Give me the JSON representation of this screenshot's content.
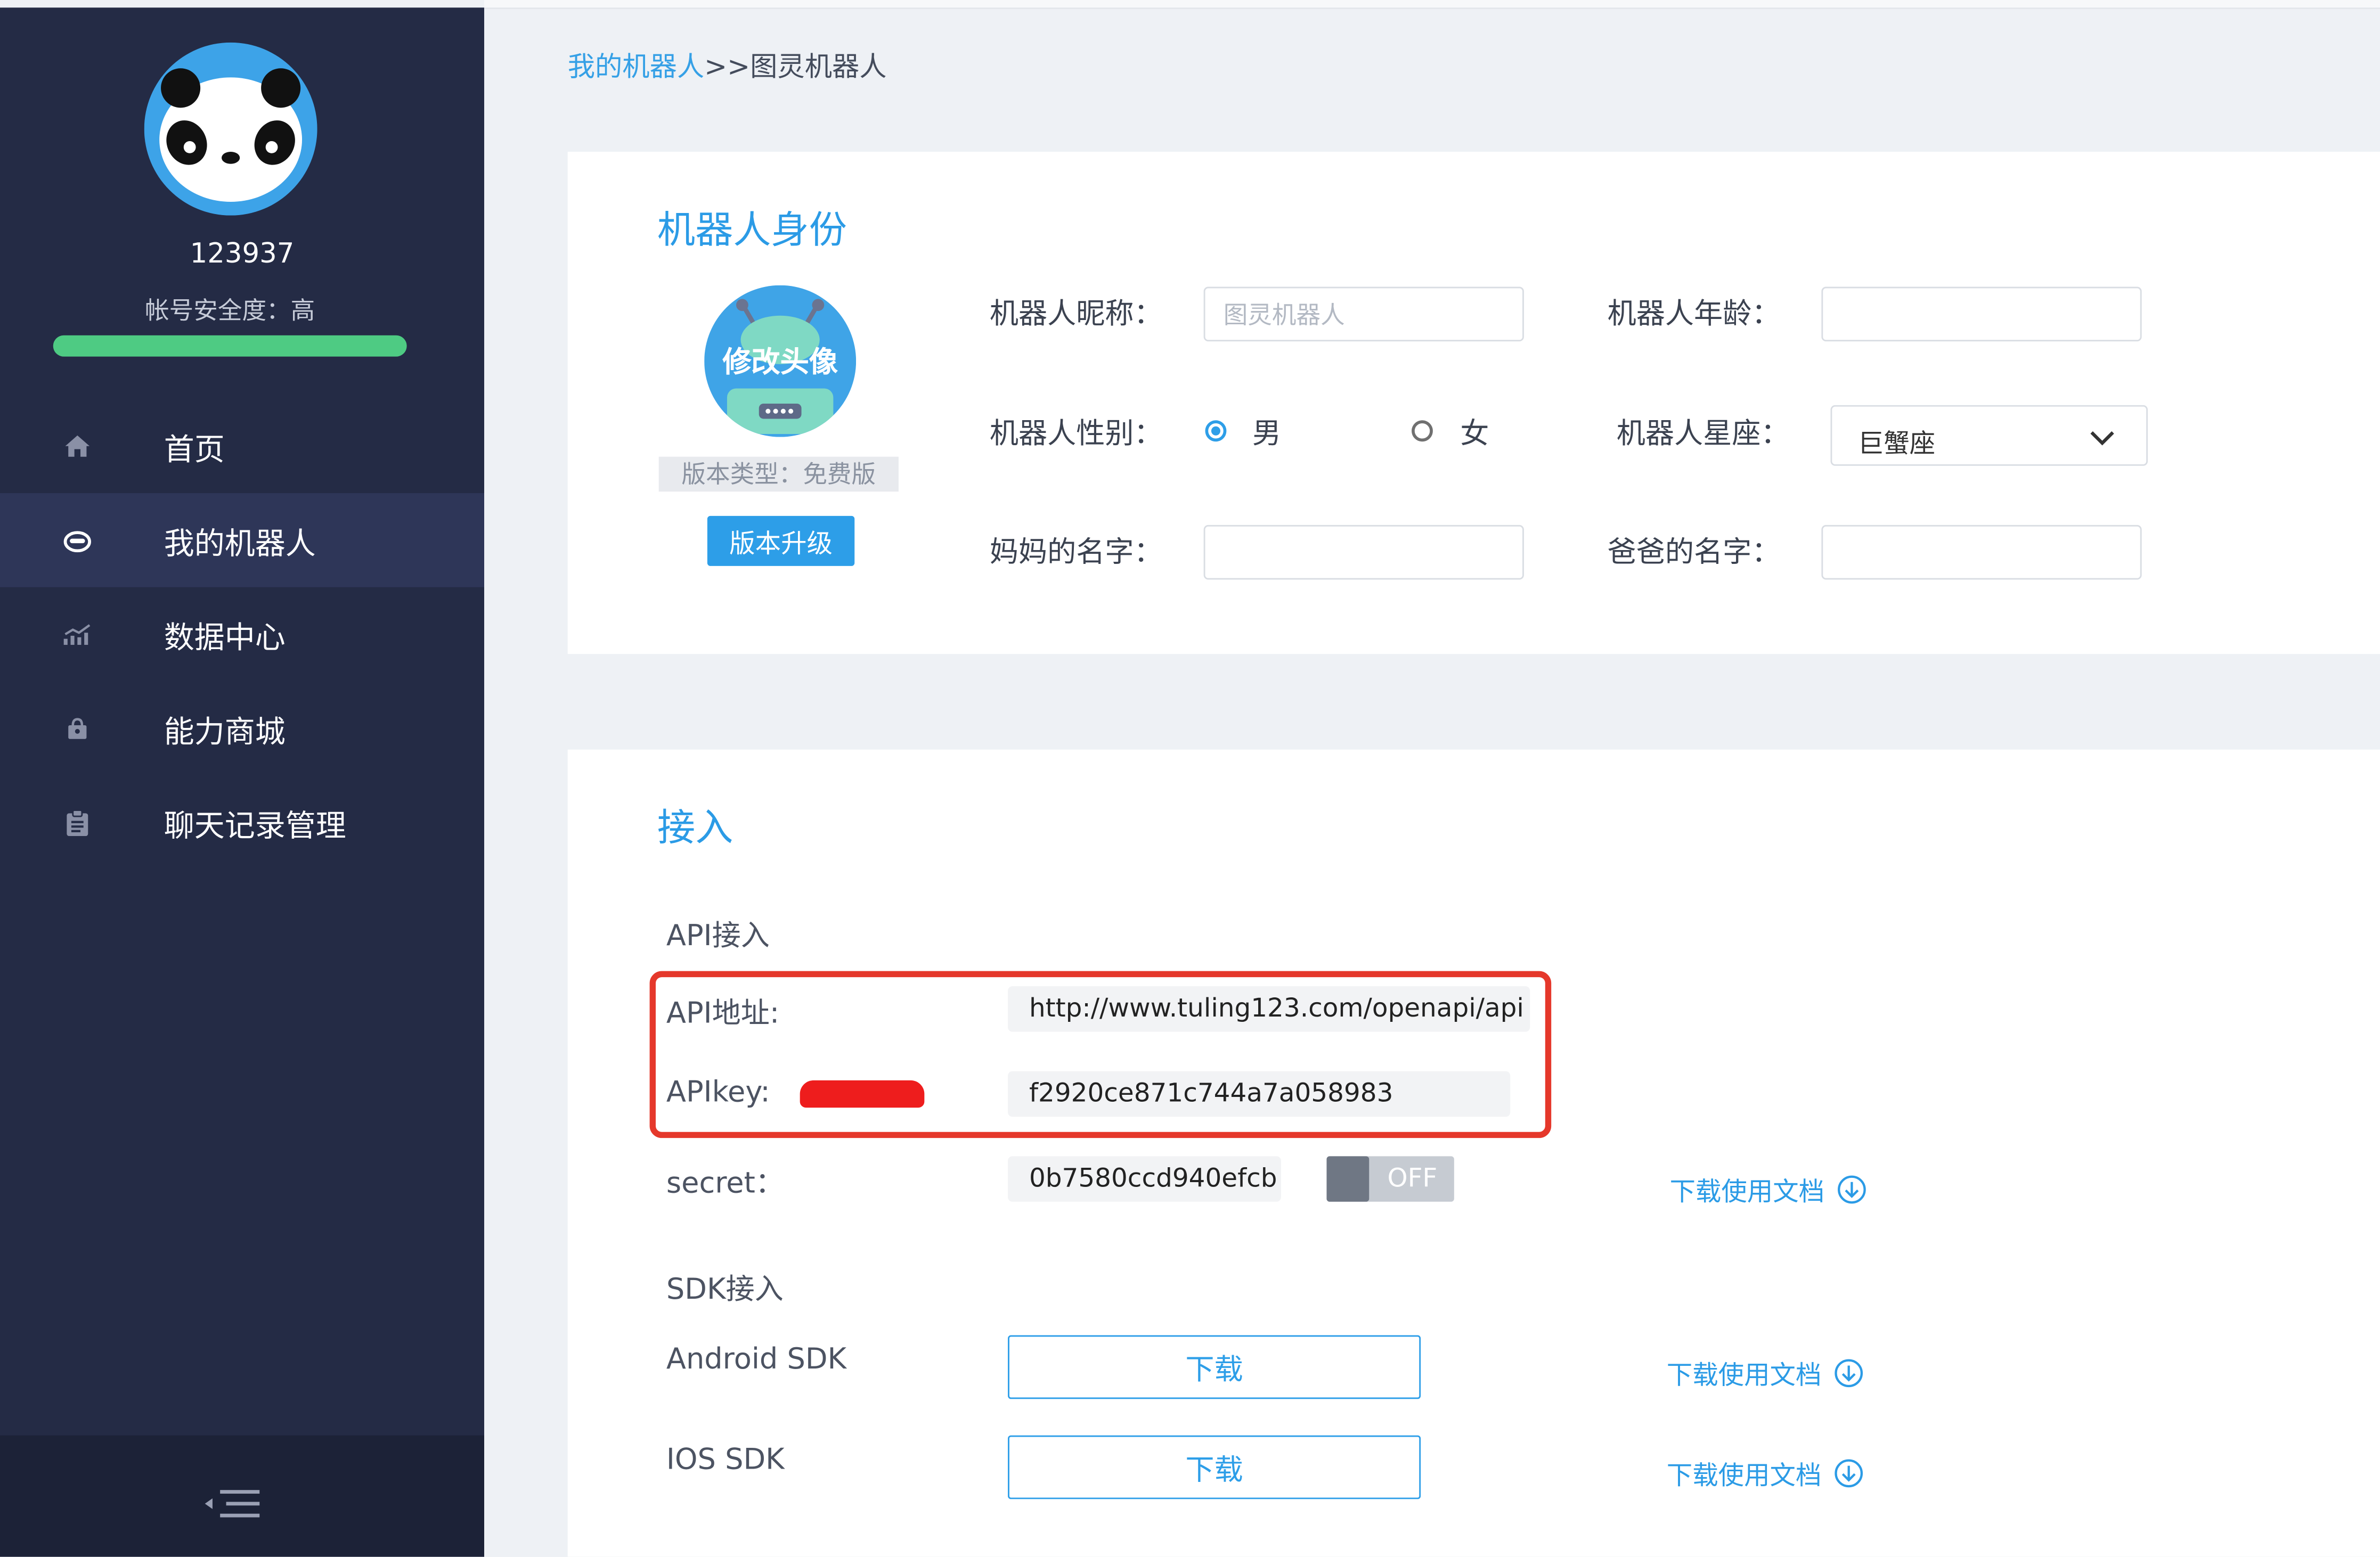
{
  "sidebar": {
    "username": "123937",
    "security": "帐号安全度：高",
    "items": [
      {
        "label": "首页",
        "icon": "home-icon"
      },
      {
        "label": "我的机器人",
        "icon": "robot-icon"
      },
      {
        "label": "数据中心",
        "icon": "chart-icon"
      },
      {
        "label": "能力商城",
        "icon": "store-icon"
      },
      {
        "label": "聊天记录管理",
        "icon": "clipboard-icon"
      }
    ],
    "active_item": "我的机器人",
    "collapse_icon": "menu-collapse-icon",
    "security_bar_color": "#4ecb83",
    "background": "#242b45"
  },
  "breadcrumb": {
    "link": "我的机器人",
    "separator": ">>",
    "current": "图灵机器人"
  },
  "identity": {
    "title": "机器人身份",
    "avatar_label": "修改头像",
    "version_type": "版本类型：免费版",
    "upgrade_button": "版本升级",
    "nickname_label": "机器人昵称：",
    "nickname_placeholder": "图灵机器人",
    "age_label": "机器人年龄：",
    "gender_label": "机器人性别：",
    "gender_male": "男",
    "gender_female": "女",
    "gender_selected": "男",
    "zodiac_label": "机器人星座：",
    "zodiac_value": "巨蟹座",
    "mother_label": "妈妈的名字：",
    "father_label": "爸爸的名字："
  },
  "access": {
    "title": "接入",
    "api_section": "API接入",
    "api_url_label": "API地址:",
    "api_url_value": "http://www.tuling123.com/openapi/api",
    "api_key_label": "APIkey:",
    "api_key_value": "f2920ce871c744a7a058983",
    "secret_label": "secret：",
    "secret_value": "0b7580ccd940efcb",
    "secret_toggle": "OFF",
    "download_doc": "下载使用文档",
    "sdk_section": "SDK接入",
    "android_label": "Android SDK",
    "ios_label": "IOS SDK",
    "download_button": "下载",
    "accent_color": "#2b9be6",
    "highlight_color": "#e5382b"
  }
}
